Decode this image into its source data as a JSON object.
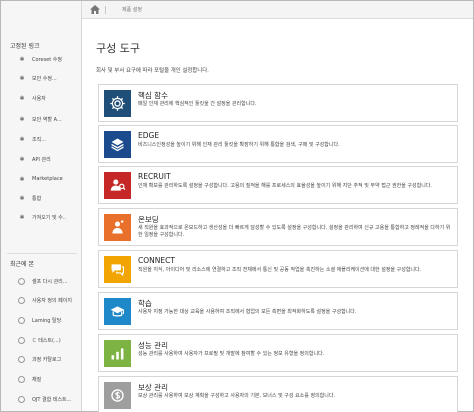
{
  "breadcrumb": {
    "current": "제품 설정"
  },
  "sidebar": {
    "section1_title": "고정된 링크",
    "pinned": [
      {
        "label": "Coreset 수정",
        "icon": "pin-icon"
      },
      {
        "label": "보안 수정...",
        "icon": "pin-icon"
      },
      {
        "label": "사용자",
        "icon": "pin-icon"
      },
      {
        "label": "보안 역할 A...",
        "icon": "pin-icon"
      },
      {
        "label": "조직...",
        "icon": "pin-icon"
      },
      {
        "label": "API 관리",
        "icon": "pin-icon"
      },
      {
        "label": "Marketplace",
        "icon": "pin-icon"
      },
      {
        "label": "통합",
        "icon": "pin-icon"
      },
      {
        "label": "가져오기 및 수..",
        "icon": "pin-icon"
      }
    ],
    "section2_title": "최근에 본",
    "recent": [
      {
        "label": "셀프 다시 관리...",
        "icon": "clock-icon"
      },
      {
        "label": "사용자 정의 페이지",
        "icon": "clock-icon"
      },
      {
        "label": "Laming 탈당",
        "icon": "clock-icon"
      },
      {
        "label": "ㄷ 테스트(...)",
        "icon": "clock-icon"
      },
      {
        "label": "과정 카탈로그",
        "icon": "clock-icon"
      },
      {
        "label": "채질",
        "icon": "clock-icon"
      },
      {
        "label": "OJT 결합 테스트...",
        "icon": "clock-icon"
      }
    ]
  },
  "main": {
    "title": "구성 도구",
    "description": "회사 및 부서 요구에 따라 포털을 개인 설정합니다.",
    "cards": [
      {
        "title": "핵심 함수",
        "desc": "매일 인재 관리에 핵심적인 툴킷을 간 설정을 관리합니다.",
        "color": "#1f4e79",
        "icon": "gear-icon"
      },
      {
        "title": "EDGE",
        "desc": "비즈니스인정성을 높이기 위해 인재 관리 툴킷을 확장하기 위해 통합을 검색, 구매 및 구성합니다.",
        "color": "#1b4b8c",
        "icon": "layers-icon"
      },
      {
        "title": "RECRUIT",
        "desc": "인재 확보를 관리하도록 설정을 구성합니다. 고용의 질적을 해를 프로세스의 효율성을 높이기 위해 지단 추적 및 부약 접근 권한을 구성합니다.",
        "color": "#c62828",
        "icon": "recruit-icon"
      },
      {
        "title": "온보딩",
        "desc": "새 직원을 효과적으로 온보드하고 생산성을 더 빠르게 달성할 수 있도록 설정을 구성합니다. 설정을 관리하여 신규 고용을 통합하고 정례적을 다하기 위한 일정을 구성합니다.",
        "color": "#e8702a",
        "icon": "onboarding-icon"
      },
      {
        "title": "CONNECT",
        "desc": "직원을 지식, 아이디어 및 리소스에 연결하고 조직 전체에서 통신 및 공동 작업을 촉진하는 소셜 애플리케이션에 대한 설정을 구성합니다.",
        "color": "#f2a500",
        "icon": "chat-icon"
      },
      {
        "title": "학습",
        "desc": "사용자 지정 가능한 대상 교육을 사용하여 조직에서 협업의 모든 측면을 최적화하도록 설정을 구성합니다.",
        "color": "#1e88c8",
        "icon": "learning-icon"
      },
      {
        "title": "성능 관리",
        "desc": "성능 관리를 사용하여 사용자가 프로필 및 개발에 참여할 수 있는 정보 유형을 정의합니다.",
        "color": "#7cb342",
        "icon": "performance-icon"
      },
      {
        "title": "보상 관리",
        "desc": "보상 관리를 사용하여 보상 계획을 구성하고 사용자의 기본, 보너스 및 구성 요소를 정의합니다.",
        "color": "#9e9e9e",
        "icon": "compensation-icon"
      }
    ]
  }
}
